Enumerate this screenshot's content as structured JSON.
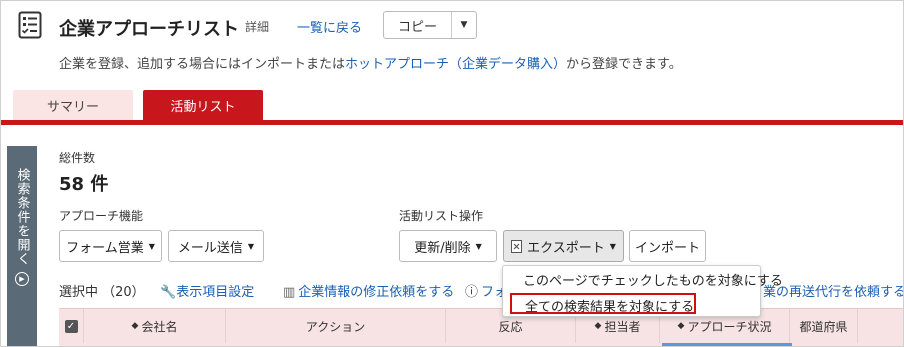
{
  "header": {
    "title": "企業アプローチリスト",
    "title_suffix": "詳細",
    "back_link": "一覧に戻る",
    "copy_label": "コピー"
  },
  "description": {
    "before": "企業を登録、追加する場合にはインポートまたは",
    "link": "ホットアプローチ（企業データ購入）",
    "after": "から登録できます。"
  },
  "tabs": [
    {
      "label": "サマリー"
    },
    {
      "label": "活動リスト"
    }
  ],
  "side_panel": {
    "label": "検索条件を開く"
  },
  "summary": {
    "total_label": "総件数",
    "total_value": "58 件"
  },
  "approach": {
    "label": "アプローチ機能",
    "form_sales": "フォーム営業",
    "mail_send": "メール送信"
  },
  "activity_ops": {
    "label": "活動リスト操作",
    "update_delete": "更新/削除",
    "export": "エクスポート",
    "import": "インポート"
  },
  "export_menu": {
    "items": [
      "このページでチェックしたものを対象にする",
      "全ての検索結果を対象にする"
    ]
  },
  "toolbar": {
    "selected": "選択中 （20）",
    "display_settings": "表示項目設定",
    "correction_request": "企業情報の修正依頼をする",
    "form_truncated": "フォ",
    "resend_truncated": "業の再送代行を依頼する"
  },
  "table": {
    "columns": [
      "会社名",
      "アクション",
      "反応",
      "担当者",
      "アプローチ状況",
      "都道府県"
    ]
  },
  "colors": {
    "accent": "#c8161d",
    "link": "#1a5fb4",
    "tab_inactive": "#fbe4e4",
    "header_row": "#f7e3e3",
    "side_panel": "#5a6a76",
    "highlight": "#d01010"
  }
}
